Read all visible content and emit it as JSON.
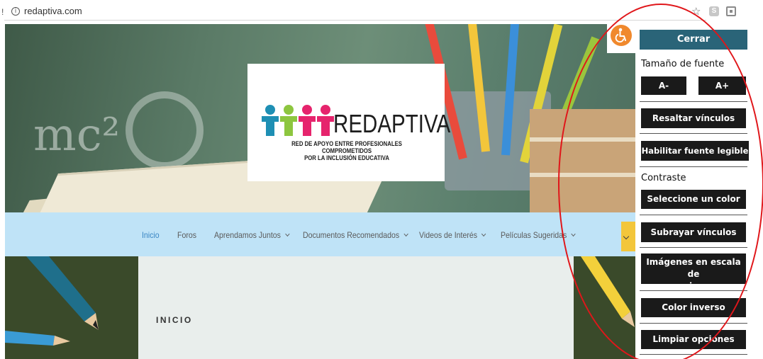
{
  "browser": {
    "url": "redaptiva.com"
  },
  "hero": {
    "logo_word": "REDAPTIVA",
    "logo_tagline_1": "RED DE APOYO ENTRE PROFESIONALES COMPROMETIDOS",
    "logo_tagline_2": "POR LA INCLUSIÓN EDUCATIVA",
    "chalk_text": "mc²"
  },
  "nav": {
    "items": [
      {
        "label": "Inicio",
        "dropdown": false,
        "active": true
      },
      {
        "label": "Foros",
        "dropdown": false,
        "active": false
      },
      {
        "label": "Aprendamos Juntos",
        "dropdown": true,
        "active": false
      },
      {
        "label": "Documentos Recomendados",
        "dropdown": true,
        "active": false
      },
      {
        "label": "Videos de Interés",
        "dropdown": true,
        "active": false
      },
      {
        "label": "Películas Sugeridas",
        "dropdown": true,
        "active": false
      }
    ]
  },
  "content": {
    "page_title": "INICIO"
  },
  "accessibility": {
    "close": "Cerrar",
    "font_size_label": "Tamaño de fuente",
    "decrease": "A-",
    "increase": "A+",
    "highlight_links": "Resaltar vínculos",
    "readable_font": "Habilitar fuente legible",
    "contrast_label": "Contraste",
    "select_color": "Seleccione un color",
    "underline_links": "Subrayar vínculos",
    "grayscale_1": "Imágenes en escala de",
    "grayscale_2": "grises",
    "invert_color": "Color inverso",
    "clear_options": "Limpiar opciones"
  },
  "colors": {
    "nav_bg": "#bfe3f7",
    "nav_active": "#3a86c4",
    "close_button": "#2a6478",
    "panel_button": "#1a1a1a",
    "a11y_icon": "#f0892d",
    "annotation": "#e0161a"
  },
  "icons": [
    "info-icon",
    "bookmark-star-icon",
    "extension-icon",
    "wheelchair-icon",
    "chevron-down-icon"
  ]
}
